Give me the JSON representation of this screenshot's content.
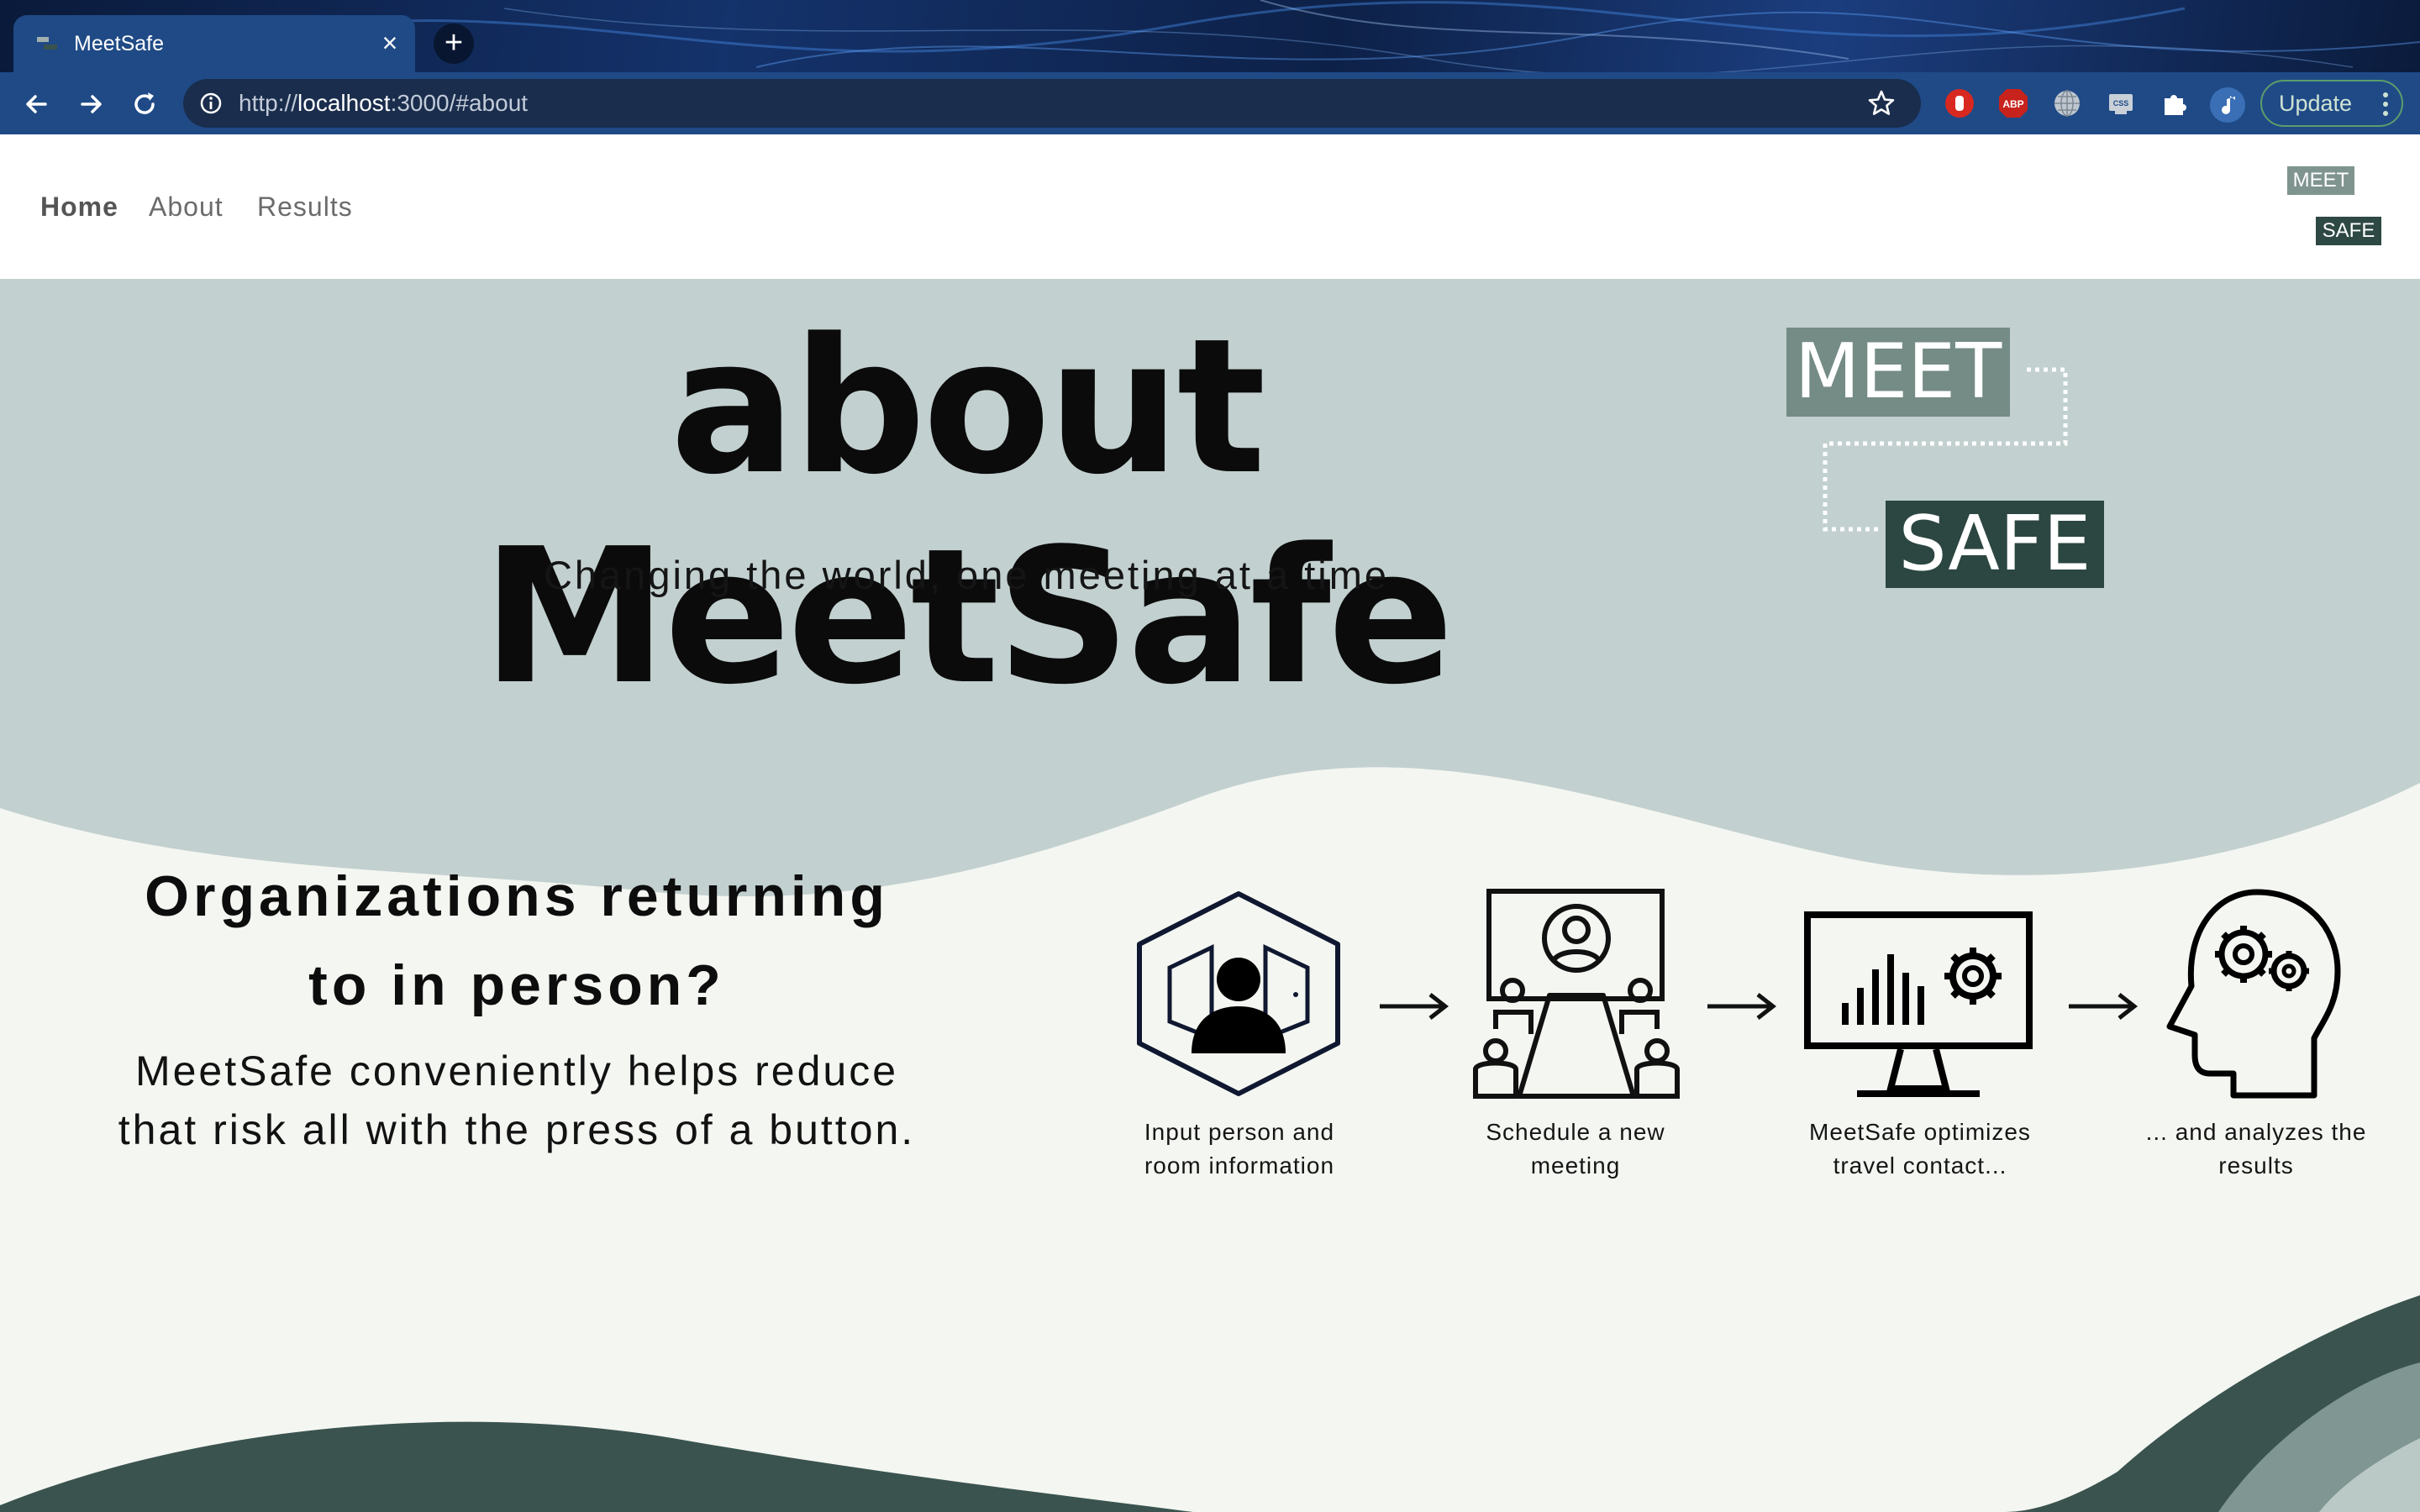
{
  "browser": {
    "tab_title": "MeetSafe",
    "tab_close": "×",
    "new_tab": "+",
    "url_scheme": "http://",
    "url_host": "localhost",
    "url_rest": ":3000/#about",
    "update_label": "Update"
  },
  "nav": {
    "home": "Home",
    "about": "About",
    "results": "Results",
    "logo_meet": "MEET",
    "logo_safe": "SAFE"
  },
  "hero": {
    "title": "about MeetSafe",
    "subtitle": "Changing the world, one meeting at a time",
    "logo_meet": "MEET",
    "logo_safe": "SAFE"
  },
  "intro": {
    "heading_line1": "Organizations returning",
    "heading_line2": "to in person?",
    "body_line1": "MeetSafe conveniently helps reduce",
    "body_line2": "that risk all with the press of a button."
  },
  "steps": [
    {
      "icon": "person-door-hexagon-icon",
      "line1": "Input person and",
      "line2": "room information"
    },
    {
      "icon": "meeting-table-icon",
      "line1": "Schedule a new",
      "line2": "meeting"
    },
    {
      "icon": "monitor-chart-gear-icon",
      "line1": "MeetSafe optimizes",
      "line2": "travel contact..."
    },
    {
      "icon": "head-gears-icon",
      "line1": "... and analyzes the",
      "line2": "results"
    }
  ],
  "colors": {
    "hero_band": "#c2d0cf",
    "page_bg": "#f4f6f1",
    "wave_dark": "#3a534f",
    "wave_mid": "#7f9692",
    "wave_light": "#bac8c6"
  }
}
